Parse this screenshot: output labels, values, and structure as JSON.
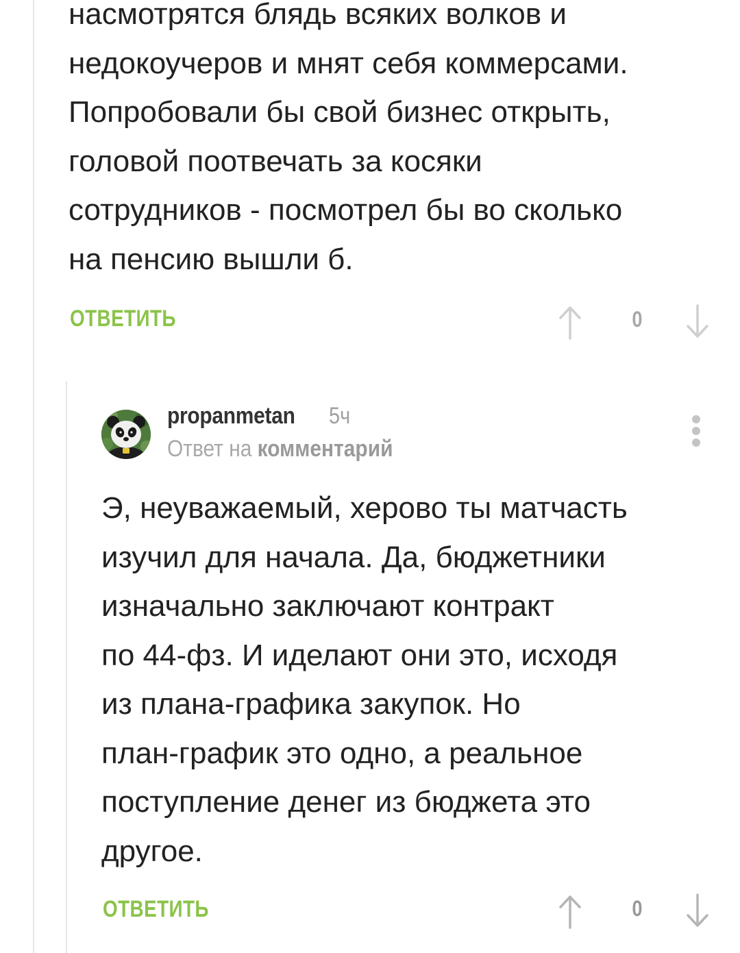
{
  "comment_prev": {
    "text": "насмотрятся блядь всяких волков и\nнедокоучеров и мнят себя коммерсами.\nПопробовали бы свой бизнес открыть,\nголовой поотвечать за косяки\nсотрудников - посмотрел бы во сколько\nна пенсию вышли б.",
    "reply_label": "ОТВЕТИТЬ",
    "vote_count": "0",
    "up_icon": "arrow-up-icon",
    "down_icon": "arrow-down-icon"
  },
  "comment_reply": {
    "author": "propanmetan",
    "time": "5ч",
    "reply_to_prefix": "Ответ на",
    "reply_to_link": "комментарий",
    "avatar_icon": "panda-avatar",
    "menu_icon": "more-vertical-icon",
    "text": "Э, неуважаемый, херово ты матчасть\nизучил для начала. Да, бюджетники\nизначально заключают контракт\nпо 44-фз. И иделают они это, исходя\nиз плана-графика закупок. Но\nплан-график это одно, а реальное\nпоступление денег из бюджета это\nдругое.",
    "reply_label": "ОТВЕТИТЬ",
    "vote_count": "0",
    "up_icon": "arrow-up-icon",
    "down_icon": "arrow-down-icon"
  },
  "colors": {
    "accent_green": "#8bc34a",
    "muted_gray": "#a8a8a8",
    "text": "#222222",
    "thread_line": "#e6e6e6"
  }
}
